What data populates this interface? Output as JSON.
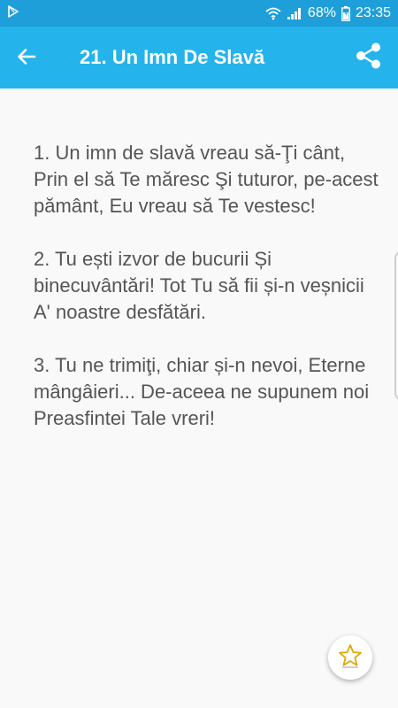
{
  "status_bar": {
    "left_icon": "play-store-notification-icon",
    "battery_percent": "68%",
    "time": "23:35",
    "icons": [
      "wifi-icon",
      "signal-icon",
      "battery-icon"
    ]
  },
  "app_bar": {
    "back_icon": "arrow-left-icon",
    "title": "21. Un Imn De Slavă",
    "share_icon": "share-icon"
  },
  "verses": [
    "1. Un imn de slavă vreau să-Ţi cânt, Prin el să Te măresc Şi tuturor, pe-acest pământ, Eu vreau să Te vestesc!",
    "2. Tu ești izvor de bucurii Și binecuvântări! Tot Tu să fii și-n veșnicii A' noastre desfătări.",
    "3. Tu ne trimiţi, chiar și-n nevoi, Eterne mângâieri... De-aceea ne supunem noi Preasfintei Tale vreri!"
  ],
  "fab": {
    "icon": "star-outline-icon"
  },
  "colors": {
    "status_bar": "#1e9fd9",
    "app_bar": "#25b3ec",
    "text": "#555555",
    "background": "#f9f9f9",
    "star": "#e0a800"
  }
}
